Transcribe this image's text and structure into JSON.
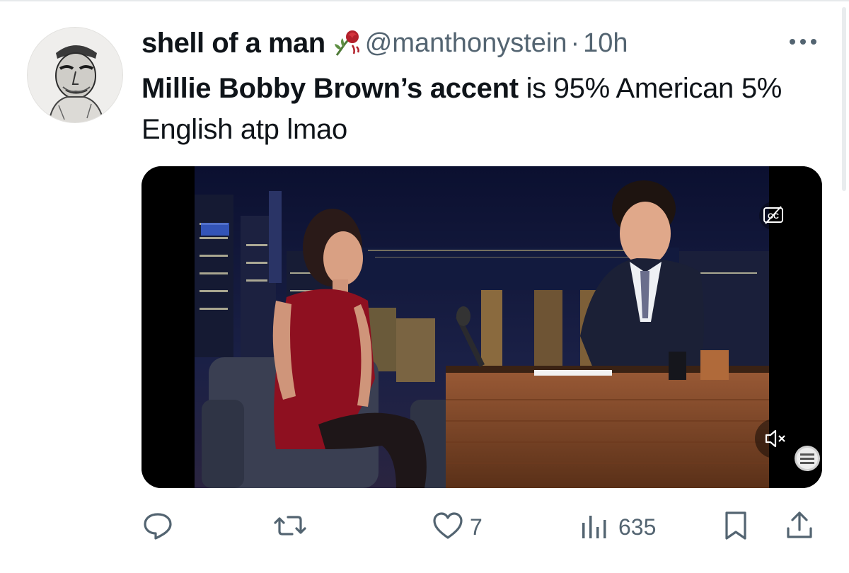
{
  "author": {
    "display_name": "shell of a man",
    "emoji_icon": "wilted-rose-icon",
    "handle": "@manthonystein",
    "separator": "·",
    "timestamp": "10h"
  },
  "tweet": {
    "bold_1": "Millie Bobby Brown’s",
    "plain_1": " ",
    "bold_2": "accent",
    "plain_2": " is 95% American 5% English atp lmao"
  },
  "actions": {
    "reply_icon": "reply-icon",
    "retweet_icon": "retweet-icon",
    "like_icon": "heart-icon",
    "like_count": "7",
    "views_icon": "views-bar-icon",
    "views_count": "635",
    "bookmark_icon": "bookmark-icon",
    "share_icon": "share-icon"
  },
  "colors": {
    "text_primary": "#0f1419",
    "text_secondary": "#536471",
    "icon": "#536471"
  }
}
